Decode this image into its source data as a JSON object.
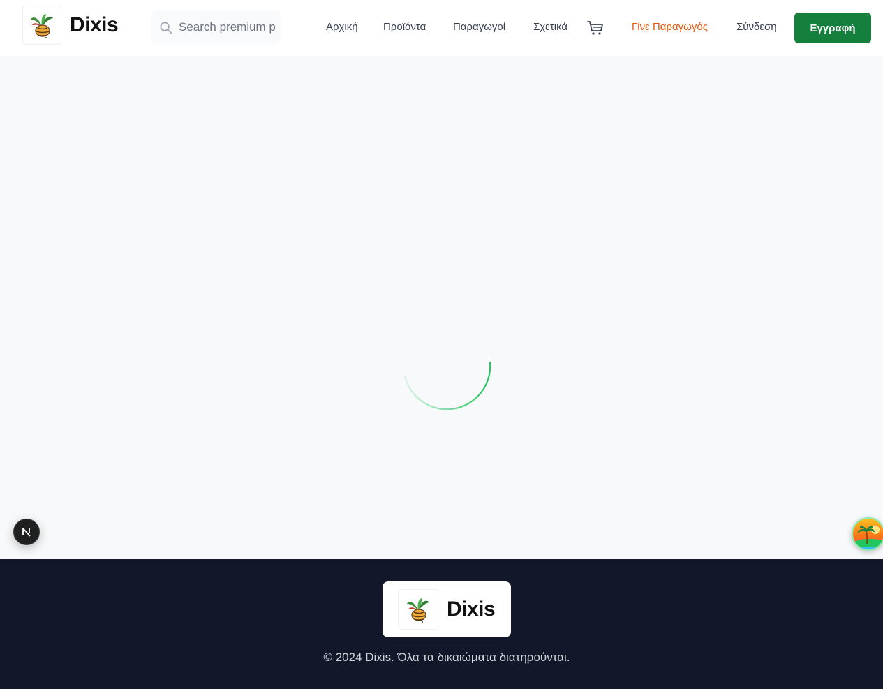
{
  "header": {
    "brand": "Dixis",
    "search": {
      "placeholder": "Search premium products..."
    },
    "nav": {
      "home": "Αρχική",
      "products": "Προϊόντα",
      "producers": "Παραγωγοί",
      "about": "Σχετικά",
      "become_producer": "Γίνε Παραγωγός",
      "login": "Σύνδεση",
      "signup": "Εγγραφή"
    },
    "icons": {
      "search": "search-icon",
      "cart": "cart-icon",
      "logo": "bee-plant-logo"
    }
  },
  "main": {
    "status": "loading"
  },
  "overlays": {
    "next_badge": "N",
    "float_icon": "palm-island-icon"
  },
  "footer": {
    "brand": "Dixis",
    "copyright": "© 2024 Dixis. Όλα τα δικαιώματα διατηρούνται."
  },
  "colors": {
    "primary": "#15803d",
    "accent_orange": "#ea580c",
    "spinner": "#22c55e",
    "footer_bg": "#121829",
    "page_bg": "#f8f9fa"
  }
}
